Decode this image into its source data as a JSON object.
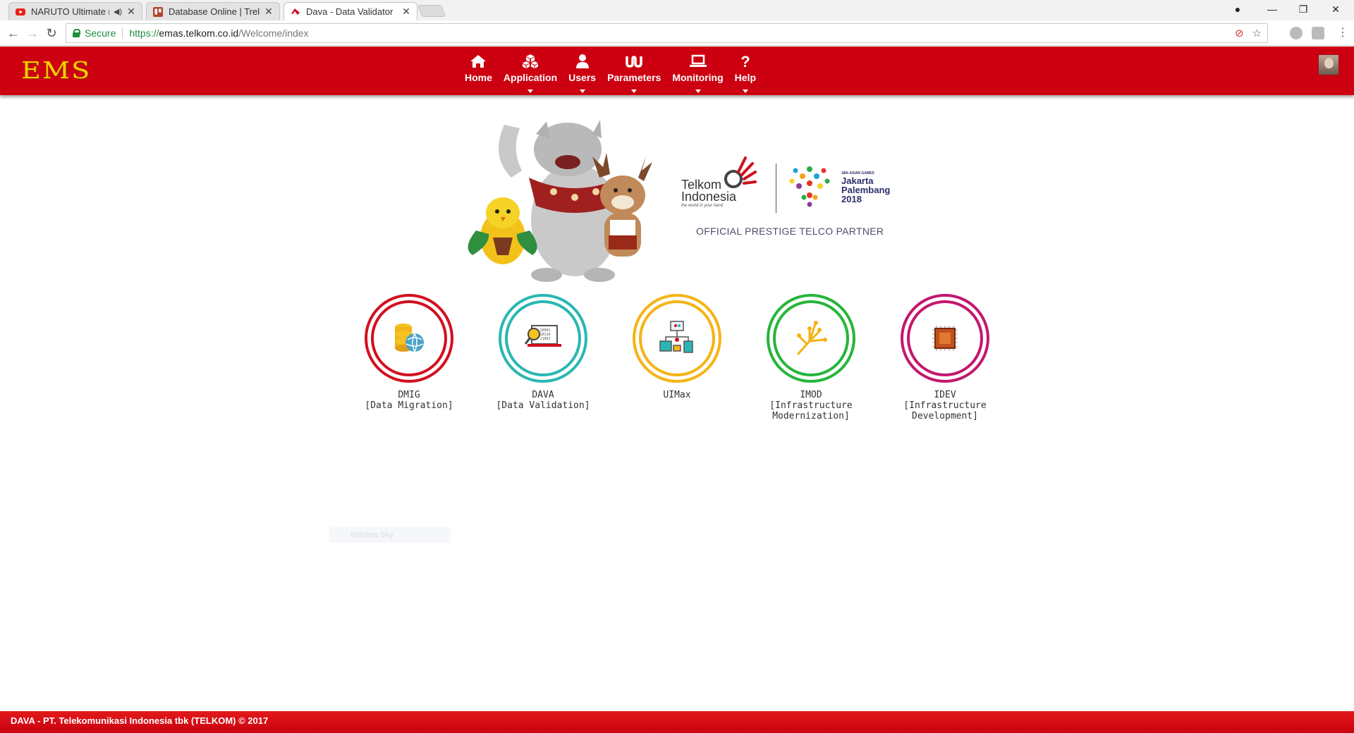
{
  "browser": {
    "tabs": [
      {
        "title": "NARUTO Ultimate mo",
        "favicon": "youtube-icon",
        "muted": true
      },
      {
        "title": "Database Online | Trello",
        "favicon": "trello-icon"
      },
      {
        "title": "Dava - Data Validator",
        "favicon": "dava-icon",
        "active": true
      }
    ],
    "secure_label": "Secure",
    "url_scheme": "https://",
    "url_host": "emas.telkom.co.id",
    "url_path": "/Welcome/index"
  },
  "header": {
    "logo": "EMS",
    "menu": [
      {
        "label": "Home",
        "icon": "home-icon",
        "dropdown": false
      },
      {
        "label": "Application",
        "icon": "cubes-icon",
        "dropdown": true
      },
      {
        "label": "Users",
        "icon": "user-icon",
        "dropdown": true
      },
      {
        "label": "Parameters",
        "icon": "parameters-icon",
        "dropdown": true
      },
      {
        "label": "Monitoring",
        "icon": "laptop-icon",
        "dropdown": true
      },
      {
        "label": "Help",
        "icon": "question-icon",
        "dropdown": true
      }
    ]
  },
  "banner": {
    "brand_line1": "Telkom",
    "brand_line2": "Indonesia",
    "brand_tagline": "the world in your hand",
    "event_small": "18th ASIAN GAMES",
    "event_line1": "Jakarta",
    "event_line2": "Palembang",
    "event_year": "2018",
    "partner_text": "OFFICIAL PRESTIGE TELCO PARTNER"
  },
  "modules": [
    {
      "code": "DMIG",
      "desc": "[Data Migration]",
      "color": "#d2101e",
      "icon": "database-globe-icon"
    },
    {
      "code": "DAVA",
      "desc": "[Data Validation]",
      "color": "#2ab7b3",
      "icon": "laptop-search-icon"
    },
    {
      "code": "UIMax",
      "desc": "",
      "color": "#f5b314",
      "icon": "network-devices-icon"
    },
    {
      "code": "IMOD",
      "desc": "[Infrastructure Modernization]",
      "color": "#27b53a",
      "icon": "circuit-icon"
    },
    {
      "code": "IDEV",
      "desc": "[Infrastructure Development]",
      "color": "#c4166f",
      "icon": "chip-icon"
    }
  ],
  "ghost_text": "Window Sky",
  "footer": {
    "text": "DAVA - PT. Telekomunikasi Indonesia tbk (TELKOM) © 2017"
  },
  "colors": {
    "header_red": "#cc0010",
    "logo_yellow": "#ffcc00"
  }
}
